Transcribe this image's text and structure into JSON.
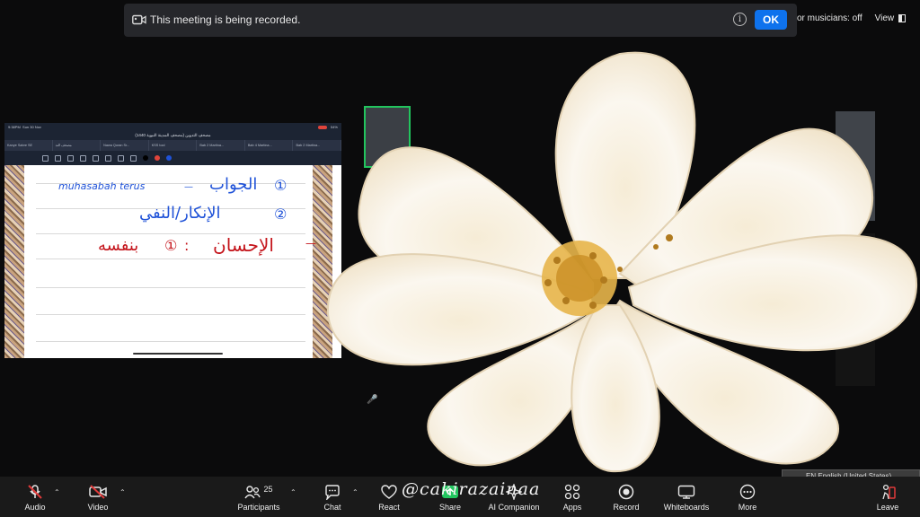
{
  "banner": {
    "recording_text": "This meeting is being recorded.",
    "info_glyph": "i",
    "ok_label": "OK"
  },
  "top_right": {
    "musicians_text": "or musicians: off",
    "view_label": "View"
  },
  "shared_screen": {
    "status_time": "9:38PM",
    "status_date": "Sun 30 Nov",
    "battery": "54%",
    "doc_title": "مصحف التدوين (مصحف المدينة النبوية 1440)",
    "tabs": [
      "Kanye Sabre SE",
      "مصحف التد",
      "Nawa Quran Sr...",
      "KSS tool",
      "Bab 2 Martina...",
      "Bab 4 Martina...",
      "Bab 2 Martina..."
    ],
    "note_line1_latin": "muhasabah terus",
    "note_line1_arabic": "الجواب",
    "note_line1_num": "①",
    "note_line2_arabic": "الإنكار/النفي",
    "note_line2_num": "②",
    "note_line3_arabic": "الإحسان",
    "note_line3_num": "①",
    "note_line3_word": "بنفسه"
  },
  "toolbar": {
    "audio": "Audio",
    "video": "Video",
    "participants": "Participants",
    "participants_count": "25",
    "chat": "Chat",
    "react": "React",
    "share": "Share",
    "ai_companion": "AI Companion",
    "apps": "Apps",
    "record": "Record",
    "whiteboards": "Whiteboards",
    "more": "More",
    "leave": "Leave",
    "watermark": "@cakirazainaa",
    "language": "EN English (United States)"
  },
  "colors": {
    "ok_blue": "#0e72ed",
    "mute_red": "#e03a3a",
    "ink_blue": "#1f52d8",
    "ink_red": "#c4141b",
    "active_tile_green": "#22c55e"
  }
}
